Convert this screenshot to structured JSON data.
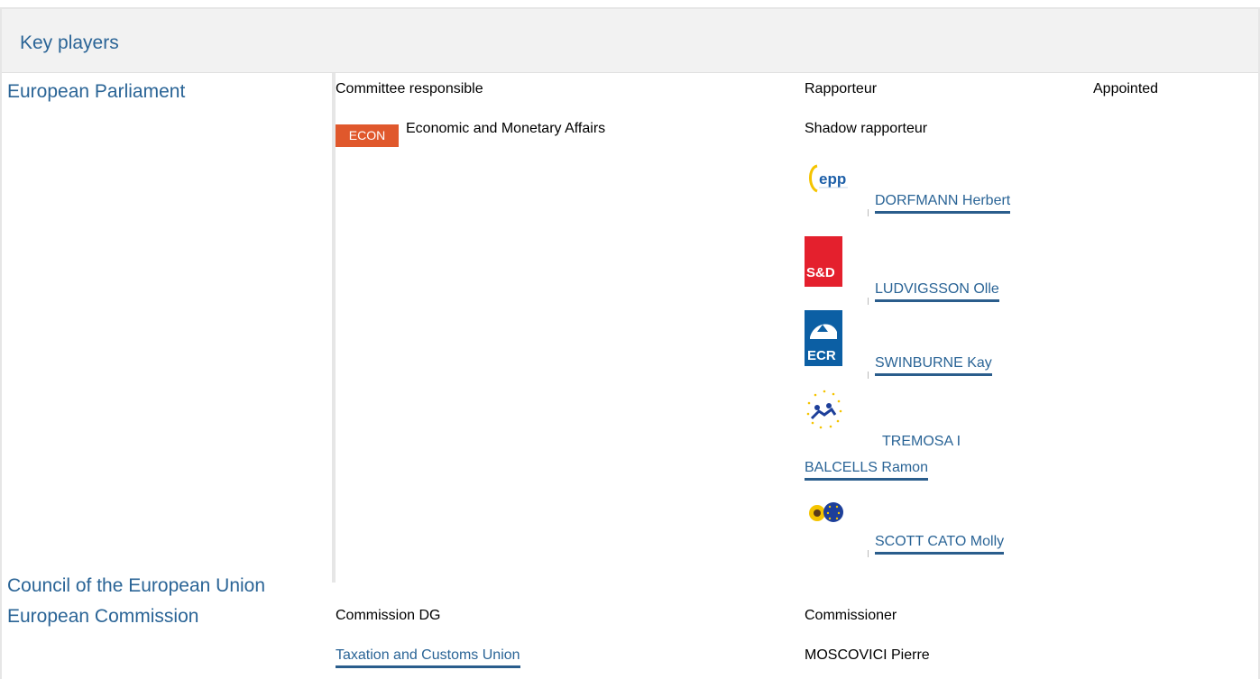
{
  "header": {
    "title": "Key players"
  },
  "sections": {
    "parliament": "European Parliament",
    "council": "Council of the European Union",
    "commission": "European Commission"
  },
  "parliament": {
    "committee_head": "Committee responsible",
    "rapporteur_head": "Rapporteur",
    "appointed_head": "Appointed",
    "committee_badge": "ECON",
    "committee_name": "Economic and Monetary Affairs",
    "shadow_head": "Shadow rapporteur",
    "shadows": [
      {
        "name": "DORFMANN Herbert",
        "group": "epp"
      },
      {
        "name": "LUDVIGSSON Olle",
        "group": "S&D"
      },
      {
        "name": "SWINBURNE Kay",
        "group": "ECR"
      },
      {
        "name_line1": "TREMOSA I",
        "name_line2": "BALCELLS Ramon",
        "group": "alde"
      },
      {
        "name": "SCOTT CATO Molly",
        "group": "greens"
      }
    ]
  },
  "commission": {
    "dg_head": "Commission DG",
    "commissioner_head": "Commissioner",
    "dg_link": "Taxation and Customs Union",
    "commissioner": "MOSCOVICI Pierre"
  },
  "colors": {
    "link": "#2a6496",
    "badge": "#e0582c",
    "sd": "#e4202d",
    "ecr": "#0c5fa4"
  }
}
